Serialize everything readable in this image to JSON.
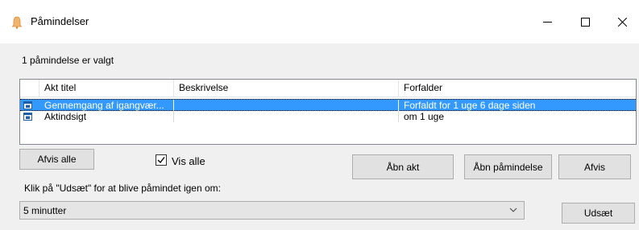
{
  "window": {
    "title": "Påmindelser"
  },
  "status": {
    "selected_text": "1 påmindelse er valgt"
  },
  "list": {
    "columns": [
      "",
      "Akt titel",
      "Beskrivelse",
      "Forfalder"
    ],
    "rows": [
      {
        "title": "Gennemgang  af  igangvær...",
        "description": "",
        "due": "Forfaldt for  1 uge 6 dage siden",
        "selected": true
      },
      {
        "title": "Aktindsigt",
        "description": "",
        "due": "om  1 uge",
        "selected": false
      }
    ]
  },
  "buttons": {
    "dismiss_all": "Afvis alle",
    "open_case": "Åbn akt",
    "open_reminder": "Åbn påmindelse",
    "dismiss": "Afvis",
    "snooze": "Udsæt"
  },
  "show_all": {
    "label": "Vis alle",
    "checked": true
  },
  "snooze": {
    "instruction": "Klik på \"Udsæt\" for at blive påmindet igen om:",
    "selected_option": "5 minutter"
  },
  "colors": {
    "selection": "#3399ff",
    "window_bg": "#f0f0f0"
  }
}
